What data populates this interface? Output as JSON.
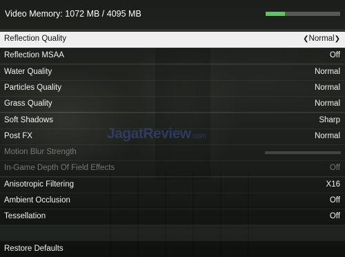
{
  "header": {
    "vram_text": "Video Memory: 1072 MB / 4095 MB",
    "vram_usage_fraction": 0.262
  },
  "settings": [
    {
      "label": "Reflection Quality",
      "value": "Normal",
      "selected": true,
      "enabled": true
    },
    {
      "label": "Reflection MSAA",
      "value": "Off",
      "selected": false,
      "enabled": true
    },
    {
      "label": "Water Quality",
      "value": "Normal",
      "selected": false,
      "enabled": true
    },
    {
      "label": "Particles Quality",
      "value": "Normal",
      "selected": false,
      "enabled": true
    },
    {
      "label": "Grass Quality",
      "value": "Normal",
      "selected": false,
      "enabled": true
    },
    {
      "label": "Soft Shadows",
      "value": "Sharp",
      "selected": false,
      "enabled": true
    },
    {
      "label": "Post FX",
      "value": "Normal",
      "selected": false,
      "enabled": true
    },
    {
      "label": "Motion Blur Strength",
      "value": "",
      "selected": false,
      "enabled": false,
      "slider": true
    },
    {
      "label": "In-Game Depth Of Field Effects",
      "value": "Off",
      "selected": false,
      "enabled": false
    },
    {
      "label": "Anisotropic Filtering",
      "value": "X16",
      "selected": false,
      "enabled": true
    },
    {
      "label": "Ambient Occlusion",
      "value": "Off",
      "selected": false,
      "enabled": true
    },
    {
      "label": "Tessellation",
      "value": "Off",
      "selected": false,
      "enabled": true
    }
  ],
  "footer": {
    "restore_label": "Restore Defaults"
  },
  "watermark": {
    "brand": "JagatReview",
    "suffix": ".com"
  },
  "icons": {
    "left_arrow": "chevron-left-icon",
    "right_arrow": "chevron-right-icon"
  },
  "colors": {
    "vram_fill": "#5ec468",
    "selected_row_bg": "#efefef"
  }
}
